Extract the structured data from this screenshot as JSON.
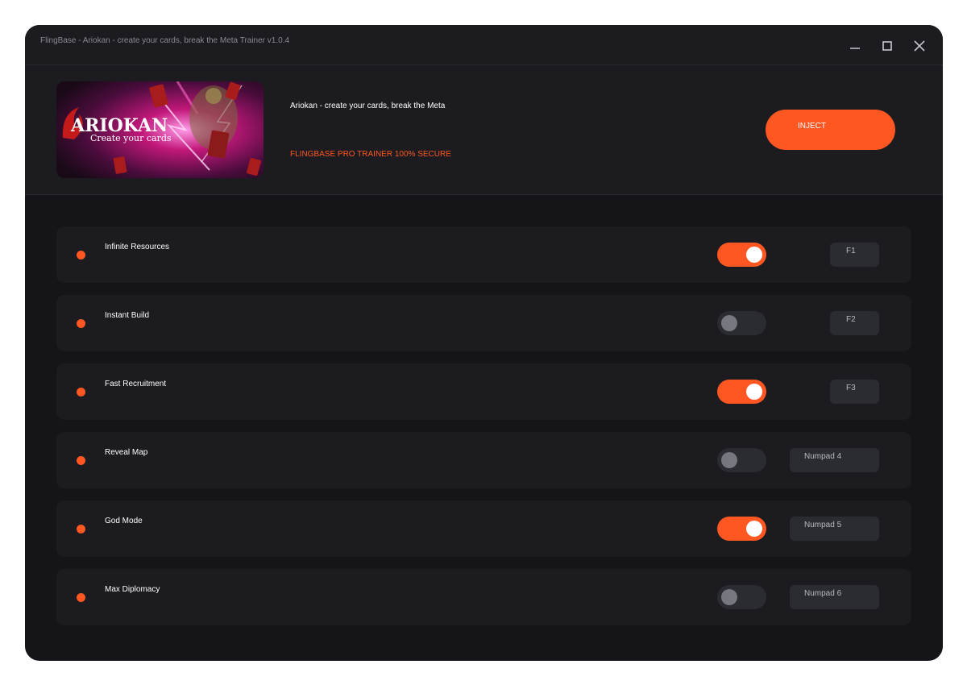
{
  "window": {
    "title": "FlingBase - Ariokan - create your cards, break the Meta Trainer v1.0.4"
  },
  "header": {
    "banner_logo_text": "ARIOKAN",
    "banner_subtitle": "Create your cards",
    "game_title": "Ariokan - create your cards, break the Meta",
    "tagline": "FLINGBASE PRO TRAINER   100% SECURE",
    "inject_label": "INJECT"
  },
  "cheats": [
    {
      "name": "Infinite Resources",
      "enabled": true,
      "hotkey": "F1"
    },
    {
      "name": "Instant Build",
      "enabled": false,
      "hotkey": "F2"
    },
    {
      "name": "Fast Recruitment",
      "enabled": true,
      "hotkey": "F3"
    },
    {
      "name": "Reveal Map",
      "enabled": false,
      "hotkey": "Numpad 4"
    },
    {
      "name": "God Mode",
      "enabled": true,
      "hotkey": "Numpad 5"
    },
    {
      "name": "Max Diplomacy",
      "enabled": false,
      "hotkey": "Numpad 6"
    }
  ],
  "colors": {
    "accent": "#ff5722",
    "window_bg": "#141419",
    "panel_bg": "#1b1b20",
    "toggle_off": "#2b2b32"
  },
  "icons": {
    "minimize": "minimize-icon",
    "maximize": "maximize-icon",
    "close": "close-icon"
  }
}
